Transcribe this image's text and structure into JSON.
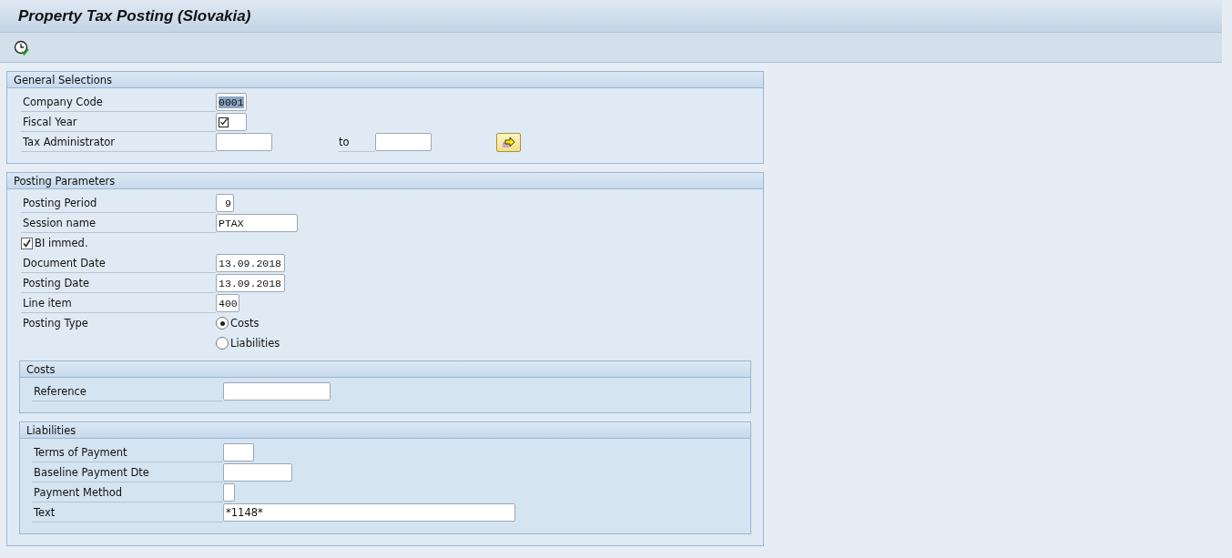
{
  "window": {
    "title": "Property Tax Posting (Slovakia)"
  },
  "sections": [
    {
      "title": "General Selections",
      "rows": [
        {
          "kind": "field",
          "label": "Company Code",
          "value": "0001",
          "highlighted": true
        },
        {
          "kind": "field",
          "label": "Fiscal Year",
          "required": true
        },
        {
          "kind": "range",
          "label": "Tax Administrator",
          "to_label": "to"
        }
      ]
    },
    {
      "title": "Posting Parameters",
      "rows": [
        {
          "kind": "field",
          "label": "Posting Period",
          "value": "9"
        },
        {
          "kind": "field",
          "label": "Session name",
          "value": "PTAX"
        },
        {
          "kind": "checkbox",
          "label": "BI immed.",
          "checked": true
        },
        {
          "kind": "field",
          "label": "Document Date",
          "value": "13.09.2018"
        },
        {
          "kind": "field",
          "label": "Posting Date",
          "value": "13.09.2018"
        },
        {
          "kind": "field",
          "label": "Line item",
          "value": "400"
        },
        {
          "kind": "radio",
          "label": "Posting Type",
          "options": [
            {
              "label": "Costs",
              "selected": true
            },
            {
              "label": "Liabilities",
              "selected": false
            }
          ]
        }
      ],
      "subsections": [
        {
          "title": "Costs",
          "rows": [
            {
              "kind": "field",
              "label": "Reference"
            }
          ]
        },
        {
          "title": "Liabilities",
          "rows": [
            {
              "kind": "field",
              "label": "Terms of Payment"
            },
            {
              "kind": "field",
              "label": "Baseline Payment Dte"
            },
            {
              "kind": "field",
              "label": "Payment Method"
            },
            {
              "kind": "field",
              "label": "Text",
              "value": "*1148*"
            }
          ]
        }
      ]
    }
  ]
}
